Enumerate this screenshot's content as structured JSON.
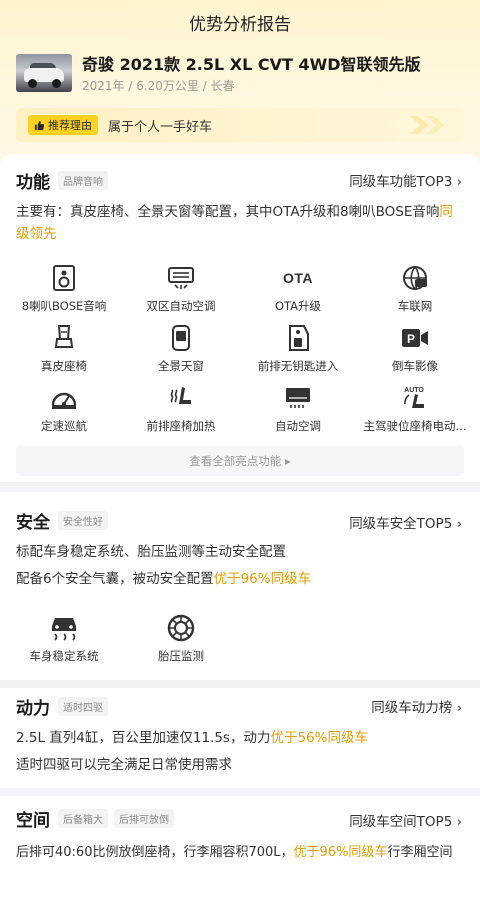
{
  "header": {
    "title": "优势分析报告"
  },
  "car": {
    "name": "奇骏 2021款 2.5L XL CVT 4WD智联领先版",
    "meta": "2021年 / 6.20万公里 / 长春"
  },
  "reason": {
    "tag": "推荐理由",
    "text": "属于个人一手好车"
  },
  "function": {
    "title": "功能",
    "badge": "品牌音响",
    "link": "同级车功能TOP3",
    "desc_prefix": "主要有：真皮座椅、全景天窗等配置，其中OTA升级和8喇叭BOSE音响",
    "desc_highlight": "同级领先",
    "features": [
      {
        "label": "8喇叭BOSE音响",
        "icon": "speaker-icon"
      },
      {
        "label": "双区自动空调",
        "icon": "dual-ac-icon"
      },
      {
        "label": "OTA升级",
        "icon": "ota-icon"
      },
      {
        "label": "车联网",
        "icon": "connected-car-icon"
      },
      {
        "label": "真皮座椅",
        "icon": "leather-seat-icon"
      },
      {
        "label": "全景天窗",
        "icon": "sunroof-icon"
      },
      {
        "label": "前排无钥匙进入",
        "icon": "keyless-entry-icon"
      },
      {
        "label": "倒车影像",
        "icon": "reverse-camera-icon"
      },
      {
        "label": "定速巡航",
        "icon": "cruise-control-icon"
      },
      {
        "label": "前排座椅加热",
        "icon": "seat-heating-icon"
      },
      {
        "label": "自动空调",
        "icon": "auto-ac-icon"
      },
      {
        "label": "主驾驶位座椅电动...",
        "icon": "power-seat-icon"
      }
    ],
    "view_all": "查看全部亮点功能"
  },
  "safety": {
    "title": "安全",
    "badge": "安全性好",
    "link": "同级车安全TOP5",
    "line1": "标配车身稳定系统、胎压监测等主动安全配置",
    "line2_prefix": "配备6个安全气囊，被动安全配置",
    "line2_highlight": "优于96%同级车",
    "features": [
      {
        "label": "车身稳定系统",
        "icon": "stability-control-icon"
      },
      {
        "label": "胎压监测",
        "icon": "tire-pressure-icon"
      }
    ]
  },
  "power": {
    "title": "动力",
    "badge": "适时四驱",
    "link": "同级车动力榜",
    "line1_prefix": "2.5L 直列4缸，百公里加速仅11.5s，动力",
    "line1_highlight": "优于56%同级车",
    "line2": "适时四驱可以完全满足日常使用需求"
  },
  "space": {
    "title": "空间",
    "badge1": "后备箱大",
    "badge2": "后排可放倒",
    "link": "同级车空间TOP5",
    "line_prefix": "后排可40:60比例放倒座椅，行李厢容积700L，",
    "line_highlight": "优于96%同级车",
    "line_suffix": "行李厢空间"
  },
  "colors": {
    "accent": "#e0a000",
    "tag": "#ffd21f",
    "header_bg": "#fff4cf"
  }
}
